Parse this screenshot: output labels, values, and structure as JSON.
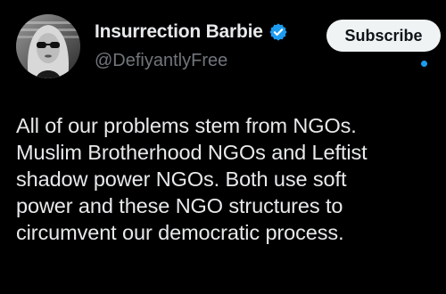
{
  "author": {
    "display_name": "Insurrection Barbie",
    "handle": "@DefiyantlyFree",
    "verified_icon": "verified-badge-icon"
  },
  "actions": {
    "subscribe_label": "Subscribe"
  },
  "post": {
    "lines": [
      "All of our problems stem from NGOs.",
      "Muslim Brotherhood NGOs and Leftist",
      "shadow power NGOs. Both use soft",
      "power and these NGO structures to",
      "circumvent our democratic process."
    ]
  },
  "colors": {
    "background": "#000000",
    "text": "#e7e9ea",
    "secondary_text": "#71767b",
    "verified": "#1d9bf0",
    "subscribe_bg": "#eff3f4"
  }
}
